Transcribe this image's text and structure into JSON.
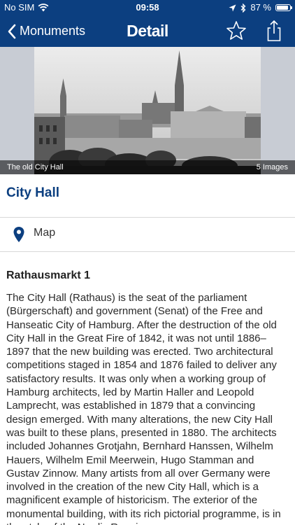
{
  "status_bar": {
    "carrier": "No SIM",
    "time": "09:58",
    "battery_percent": "87 %",
    "battery_level": 0.87,
    "icons": [
      "wifi-icon",
      "location-arrow-icon",
      "bluetooth-icon",
      "battery-icon"
    ]
  },
  "nav": {
    "back_label": "Monuments",
    "title": "Detail",
    "icons": [
      "chevron-left-icon",
      "star-icon",
      "share-icon"
    ]
  },
  "photo": {
    "caption": "The old City Hall",
    "image_count": "5 Images"
  },
  "monument": {
    "name": "City Hall",
    "map_label": "Map",
    "address": "Rathausmarkt 1",
    "description": "The City Hall (Rathaus) is the seat of the parliament (Bürgerschaft) and government (Senat) of the Free and Hanseatic City of Hamburg. After the destruction of the old City Hall in the Great Fire of 1842, it was not until 1886–1897 that the new building was erected. Two architectural competitions staged in 1854 and 1876 failed to deliver any satisfactory results. It was only when a working group of Hamburg architects, led by Martin Haller and Leopold Lamprecht, was established in 1879 that a convincing design emerged. With many alterations, the new City Hall was built to these plans, presented in 1880. The architects included Johannes Grotjahn, Bernhard Hanssen, Wilhelm Hauers, Wilhelm Emil Meerwein, Hugo Stamman and Gustav Zinnow. Many artists from all over Germany were involved in the creation of the new City Hall, which is a magnificent example of historicism. The exterior of the monumental building, with its rich pictorial programme, is in the style of the Nordic Renaissance."
  },
  "colors": {
    "brand_blue": "#0c3f80",
    "divider": "#d8d8d8"
  }
}
